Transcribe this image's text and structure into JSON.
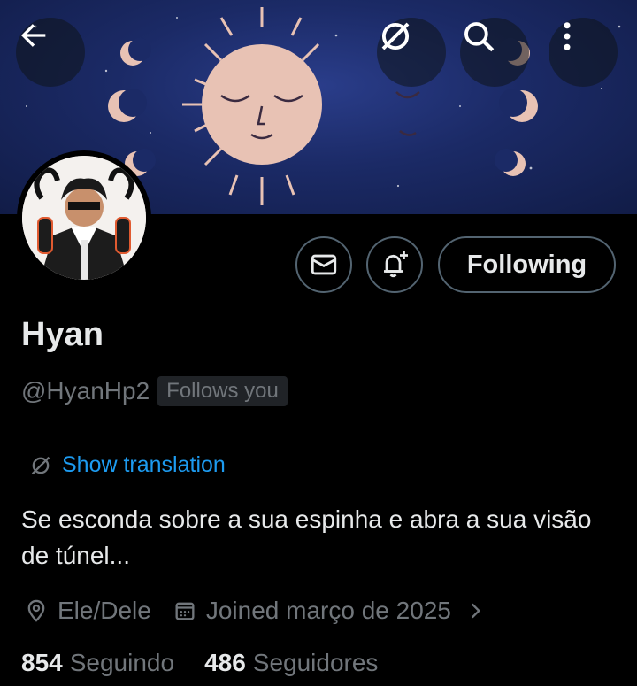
{
  "profile": {
    "name": "Hyan",
    "handle": "@HyanHp2",
    "follows_you_badge": "Follows you",
    "show_translation": "Show translation",
    "bio": "Se esconda sobre a sua espinha e abra a sua visão de túnel...",
    "pronouns": "Ele/Dele",
    "joined": "Joined março de 2025"
  },
  "actions": {
    "following_label": "Following"
  },
  "stats": {
    "following_count": "854",
    "following_label": "Seguindo",
    "followers_count": "486",
    "followers_label": "Seguidores"
  },
  "icons": {
    "back": "arrow-left-icon",
    "translate": "translate-icon",
    "search": "search-icon",
    "more": "more-vertical-icon",
    "message": "envelope-icon",
    "notify": "bell-plus-icon",
    "location": "location-pin-icon",
    "calendar": "calendar-icon",
    "expand": "chevron-right-icon"
  },
  "colors": {
    "background": "#000000",
    "text_primary": "#e7e9ea",
    "text_secondary": "#71767b",
    "link": "#1d9bf0",
    "border": "#536471",
    "banner": "#1b2a66"
  }
}
